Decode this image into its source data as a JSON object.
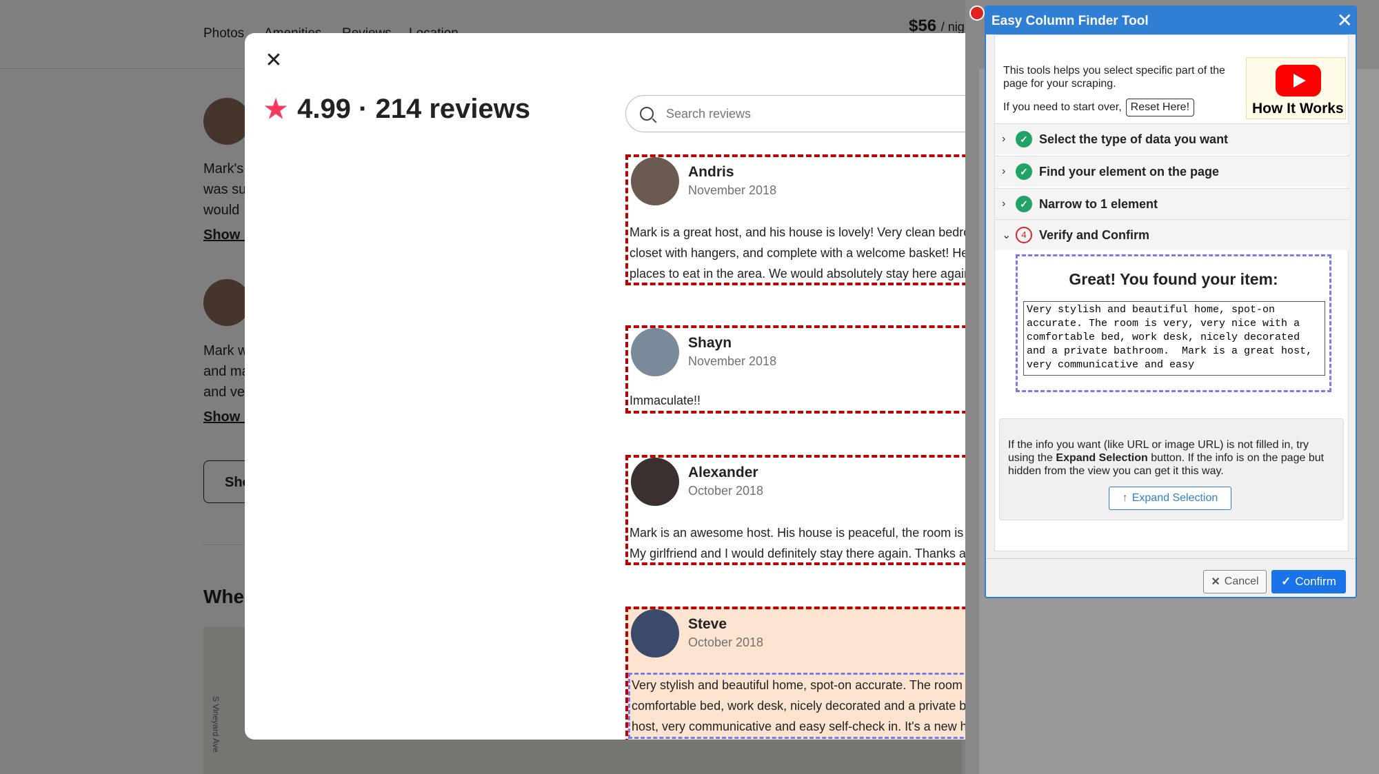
{
  "background": {
    "nav": [
      "Photos",
      "Amenities",
      "Reviews",
      "Location"
    ],
    "price": "$56",
    "price_unit": "/ nig",
    "review_snippets": [
      {
        "lines": [
          "Mark's",
          "was su",
          "would"
        ],
        "show": "Show m"
      },
      {
        "lines": [
          "Mark w",
          "and ma",
          "and ve"
        ],
        "show": "Show m"
      }
    ],
    "show_all": "Sho",
    "where_heading": "Whe",
    "map_street": "S Vineyard Ave"
  },
  "reviews_modal": {
    "close_glyph": "✕",
    "rating": "4.99 · 214 reviews",
    "search_placeholder": "Search reviews",
    "reviews": [
      {
        "name": "Andris",
        "date": "November 2018",
        "lines": [
          "Mark is a great host, and his house is lovely! Very clean bedroom,",
          "closet with hangers, and complete with a welcome basket! He",
          "places to eat in the area. We would absolutely stay here again"
        ]
      },
      {
        "name": "Shayn",
        "date": "November 2018",
        "lines": [
          "Immaculate!!"
        ]
      },
      {
        "name": "Alexander",
        "date": "October 2018",
        "lines": [
          "Mark is an awesome host. His house is peaceful, the room is s",
          "My girlfriend and I would definitely stay there again. Thanks a"
        ]
      },
      {
        "name": "Steve",
        "date": "October 2018",
        "lines": [
          "Very stylish and beautiful home, spot-on accurate. The room",
          "comfortable bed, work desk, nicely decorated and a private b",
          "host, very communicative and easy self-check in. It's a new ho"
        ]
      }
    ]
  },
  "extension": {
    "title": "Easy Column Finder Tool",
    "close_glyph": "✕",
    "intro": "This tools helps you select specific part of the page for your scraping.",
    "restart_text": "If you need to start over,",
    "reset_label": "Reset Here!",
    "how_it_works": "How It Works",
    "steps": [
      {
        "label": "Select the type of data you want",
        "status": "done"
      },
      {
        "label": "Find your element on the page",
        "status": "done"
      },
      {
        "label": "Narrow to 1 element",
        "status": "done"
      },
      {
        "label": "Verify and Confirm",
        "status": "4"
      }
    ],
    "found_title": "Great! You found your item:",
    "found_text": "Very stylish and beautiful home, spot-on accurate. The room is very, very nice with a comfortable bed, work desk, nicely decorated and a private bathroom.  Mark is a great host, very communicative and easy",
    "expand_info_pre": "If the info you want (like URL or image URL) is not filled in, try using the ",
    "expand_info_bold": "Expand Selection",
    "expand_info_post": " button. If the info is on the page but hidden from the view you can get it this way.",
    "expand_label": "Expand Selection",
    "cancel_label": "Cancel",
    "confirm_label": "Confirm",
    "colors": {
      "accent": "#2f7fd4",
      "check": "#21a366",
      "highlight": "#fde4d0",
      "dash_red": "#c00000",
      "dash_purple": "#7a7af0",
      "airbnb": "#ff385c"
    }
  }
}
